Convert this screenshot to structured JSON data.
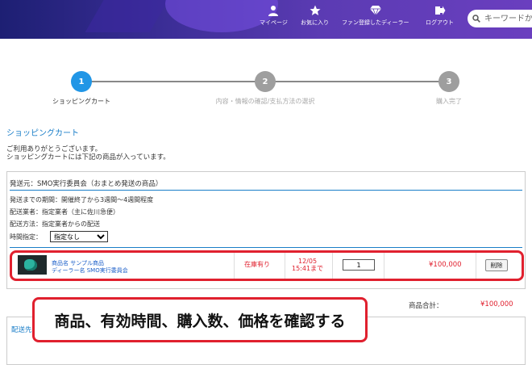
{
  "header": {
    "nav": [
      {
        "label": "マイページ",
        "icon": "user-icon"
      },
      {
        "label": "お気に入り",
        "icon": "star-icon"
      },
      {
        "label": "ファン登録したディーラー",
        "icon": "diamond-icon"
      },
      {
        "label": "ログアウト",
        "icon": "logout-icon"
      }
    ],
    "search_placeholder": "キーワードか"
  },
  "steps": [
    {
      "num": "1",
      "label": "ショッピングカート",
      "active": true
    },
    {
      "num": "2",
      "label": "内容・情報の確認/支払方法の選択",
      "active": false
    },
    {
      "num": "3",
      "label": "購入完了",
      "active": false
    }
  ],
  "page_title": "ショッピングカート",
  "intro": {
    "line1": "ご利用ありがとうございます。",
    "line2": "ショッピングカートには下記の商品が入っています。"
  },
  "shipment": {
    "origin": "発送元：SMO実行委員会（おまとめ発送の商品）",
    "period": "発送までの期間：開催終了から3週間～4週間程度",
    "carrier": "配送業者：指定業者（主に佐川急便）",
    "method": "配送方法：指定業者からの配送",
    "time_label": "時間指定：",
    "time_selected": "指定なし"
  },
  "item": {
    "name": "商品名 サンプル商品",
    "dealer": "ディーラー名 SMO実行委員会",
    "stock": "在庫有り",
    "deadline_date": "12/05",
    "deadline_time": "15:41まで",
    "quantity": "1",
    "price": "¥100,000",
    "delete_label": "削除"
  },
  "total": {
    "label": "商品合計：",
    "value": "¥100,000"
  },
  "bottom_label": "配送先",
  "callout": "商品、有効時間、購入数、価格を確認する",
  "colors": {
    "accent_blue": "#1a7ec8",
    "highlight_red": "#e0202e",
    "step_active": "#2196e6",
    "step_inactive": "#9e9e9e"
  }
}
